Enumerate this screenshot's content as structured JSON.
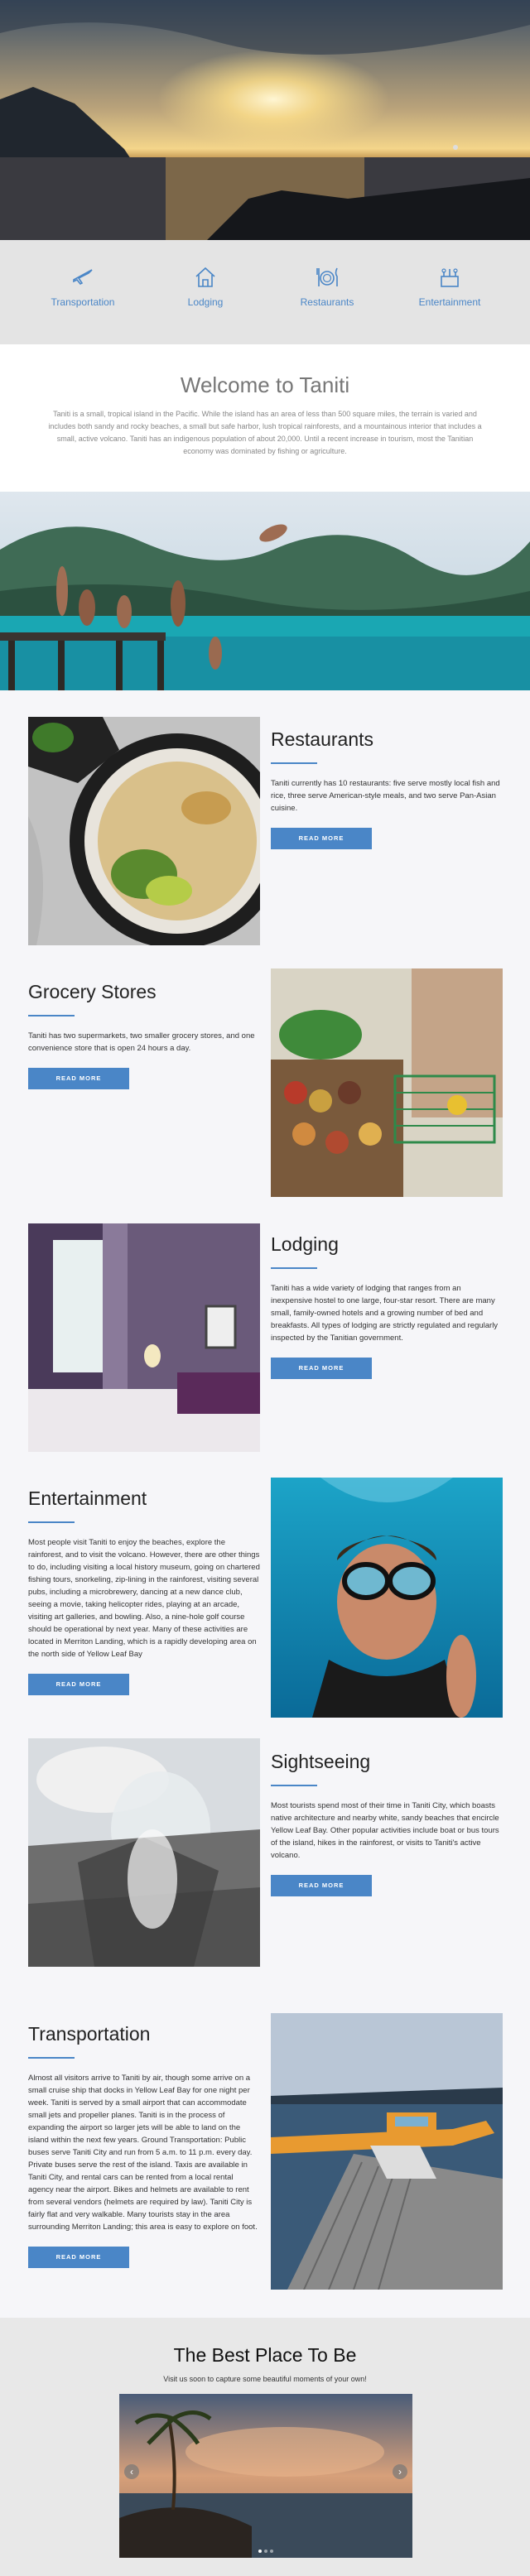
{
  "nav": [
    {
      "label": "Transportation",
      "icon": "plane-icon"
    },
    {
      "label": "Lodging",
      "icon": "house-icon"
    },
    {
      "label": "Restaurants",
      "icon": "dining-icon"
    },
    {
      "label": "Entertainment",
      "icon": "entertainment-icon"
    }
  ],
  "welcome": {
    "title": "Welcome to Taniti",
    "body": "Taniti is a small, tropical island in the Pacific. While the island has an area of less than 500 square miles, the terrain is varied and includes both sandy and rocky beaches, a small but safe harbor, lush tropical rainforests, and a mountainous interior that includes a small, active volcano. Taniti has an indigenous population of about 20,000. Until a recent increase in tourism, most the Tanitian economy was dominated by fishing or agriculture."
  },
  "sections": [
    {
      "title": "Restaurants",
      "body": "Taniti currently has 10 restaurants: five serve mostly local fish and rice, three serve American-style meals, and two serve Pan-Asian cuisine.",
      "button": "READ MORE"
    },
    {
      "title": "Grocery Stores",
      "body": "Taniti has two supermarkets, two smaller grocery stores, and one convenience store that is open 24 hours a day.",
      "button": "READ MORE"
    },
    {
      "title": "Lodging",
      "body": "Taniti has a wide variety of lodging that ranges from an inexpensive hostel to one large, four-star resort. There are many small, family-owned hotels and a growing number of bed and breakfasts. All types of lodging are strictly regulated and regularly inspected by the Tanitian government.",
      "button": "READ MORE"
    },
    {
      "title": "Entertainment",
      "body": "Most people visit Taniti to enjoy the beaches, explore the rainforest, and to visit the volcano. However, there are other things to do, including visiting a local history museum, going on chartered fishing tours, snorkeling, zip-lining in the rainforest, visiting several pubs, including a microbrewery, dancing at a new dance club, seeing a movie, taking helicopter rides, playing at an arcade, visiting art galleries, and bowling. Also, a nine-hole golf course should be operational by next year. Many of these activities are located in Merriton Landing, which is a rapidly developing area on the north side of Yellow Leaf Bay",
      "button": "READ MORE"
    },
    {
      "title": "Sightseeing",
      "body": "Most tourists spend most of their time in Taniti City, which boasts native architecture and nearby white, sandy beaches that encircle Yellow Leaf Bay. Other popular activities include boat or bus tours of the island, hikes in the rainforest, or visits to Taniti's active volcano.",
      "button": "READ MORE"
    },
    {
      "title": "Transportation",
      "body": "Almost all visitors arrive to Taniti by air, though some arrive on a small cruise ship that docks in Yellow Leaf Bay for one night per week. Taniti is served by a small airport that can accommodate small jets and propeller planes. Taniti is in the process of expanding the airport so larger jets will be able to land on the island within the next few years. Ground Transportation: Public buses serve Taniti City and run from 5 a.m. to 11 p.m. every day. Private buses serve the rest of the island. Taxis are available in Taniti City, and rental cars can be rented from a local rental agency near the airport. Bikes and helmets are available to rent from several vendors (helmets are required by law). Taniti City is fairly flat and very walkable. Many tourists stay in the area surrounding Merriton Landing; this area is easy to explore on foot.",
      "button": "READ MORE"
    }
  ],
  "best": {
    "title": "The Best Place To Be",
    "subtitle": "Visit us soon to capture some beautiful moments of your own!",
    "prev": "‹",
    "next": "›"
  }
}
